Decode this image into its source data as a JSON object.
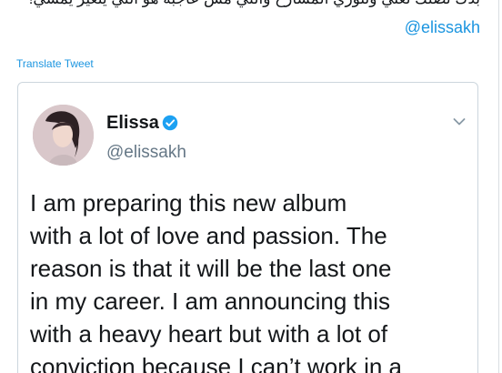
{
  "parent_tweet": {
    "arabic_text": "بدك تضلك تغني وتنوري المسارح  واللي مش عاجبه هو اللي يتغير يمشي!",
    "mention": "@elissakh",
    "translate_label": "Translate Tweet"
  },
  "quoted_tweet": {
    "author_name": "Elissa",
    "author_handle": "@elissakh",
    "verified": true,
    "body_lines": [
      "I am preparing this new album",
      "with a lot of love and passion. The",
      "reason is that it will be the last one",
      "in my career. I am announcing this",
      "with a heavy heart but with a lot of",
      "conviction because I can’t work in a"
    ]
  },
  "colors": {
    "link_blue": "#1b95e0",
    "text_primary": "#14171a",
    "text_secondary": "#657786",
    "border": "#ccd6dd"
  },
  "icons": {
    "verified": "verified-badge-icon",
    "caret": "chevron-down-icon",
    "avatar": "avatar-photo"
  }
}
